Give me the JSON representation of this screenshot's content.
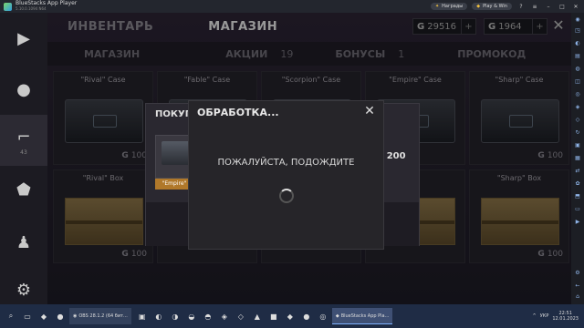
{
  "titlebar": {
    "title": "BlueStacks App Player",
    "version": "5.10.0.1094 N64",
    "rewards_label": "Награды",
    "playwin_label": "Play & Win"
  },
  "topnav": {
    "tabs": [
      {
        "label": "ИНВЕНТАРЬ"
      },
      {
        "label": "МАГАЗИН"
      }
    ],
    "currency1": {
      "value": "29516"
    },
    "currency2": {
      "value": "1964"
    },
    "currency_symbol": "G"
  },
  "subnav": {
    "shop": "МАГАЗИН",
    "promos": "АКЦИИ",
    "promos_count": "19",
    "bonuses": "БОНУСЫ",
    "bonuses_count": "1",
    "promocode": "ПРОМОКОД"
  },
  "leftbar": {
    "level": "43"
  },
  "shop_items": [
    {
      "name": "\"Rival\" Case",
      "price": "100"
    },
    {
      "name": "\"Fable\" Case",
      "price": ""
    },
    {
      "name": "\"Scorpion\" Case",
      "price": ""
    },
    {
      "name": "\"Empire\" Case",
      "price": ""
    },
    {
      "name": "\"Sharp\" Case",
      "price": "100"
    },
    {
      "name": "\"Rival\" Box",
      "price": "100"
    },
    {
      "name": "",
      "price": ""
    },
    {
      "name": "",
      "price": ""
    },
    {
      "name": "",
      "price": ""
    },
    {
      "name": "\"Sharp\" Box",
      "price": "100"
    }
  ],
  "purchase_dialog": {
    "title": "ПОКУПК",
    "item_label": "\"Empire\" C",
    "price": "200"
  },
  "modal": {
    "title": "ОБРАБОТКА...",
    "message": "ПОЖАЛУЙСТА, ПОДОЖДИТЕ"
  },
  "taskbar": {
    "obs": "OBS 28.1.2 (64 бит...",
    "bluestacks": "BlueStacks App Pla...",
    "lang": "УКР",
    "time": "22:51",
    "date": "12.01.2023"
  }
}
